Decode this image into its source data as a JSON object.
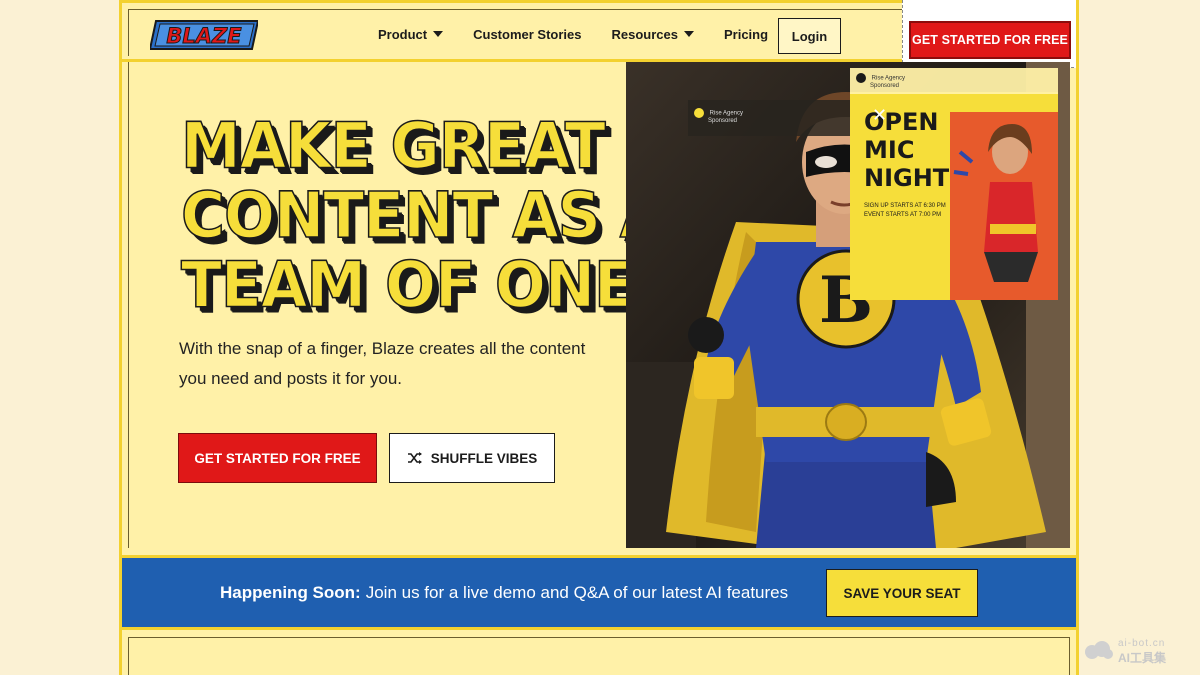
{
  "brand": {
    "logo_text": "BLAZE",
    "primary": "#e01818",
    "yellow": "#f6de3a",
    "blue": "#1f5fb0"
  },
  "nav": {
    "items": [
      {
        "label": "Product",
        "has_caret": true
      },
      {
        "label": "Customer Stories",
        "has_caret": false
      },
      {
        "label": "Resources",
        "has_caret": true
      },
      {
        "label": "Pricing",
        "has_caret": false
      }
    ],
    "login": "Login",
    "cta": "GET STARTED FOR FREE"
  },
  "hero": {
    "headline_lines": [
      "MAKE GREAT",
      "CONTENT AS A",
      "TEAM OF ONE"
    ],
    "subtext": "With the snap of a finger, Blaze creates all the content you need and posts it for you.",
    "primary_button": "GET STARTED FOR FREE",
    "secondary_button": "SHUFFLE VIBES",
    "secondary_icon": "shuffle-icon"
  },
  "art": {
    "card1": {
      "name": "Rise Agency",
      "sub": "Sponsored"
    },
    "card2": {
      "name": "Rise Agency",
      "sub": "Sponsored"
    },
    "poster_title": [
      "OPEN",
      "MIC",
      "NIGHT"
    ],
    "poster_small": [
      "SIGN UP STARTS AT 6:30 PM",
      "EVENT STARTS AT 7:00 PM"
    ],
    "chest_letter": "B"
  },
  "banner": {
    "lead": "Happening Soon:",
    "text": "Join us for a live demo and Q&A of our latest AI features",
    "button": "SAVE YOUR SEAT"
  },
  "watermark": {
    "top": "ai-bot.cn",
    "bottom": "AI工具集"
  }
}
